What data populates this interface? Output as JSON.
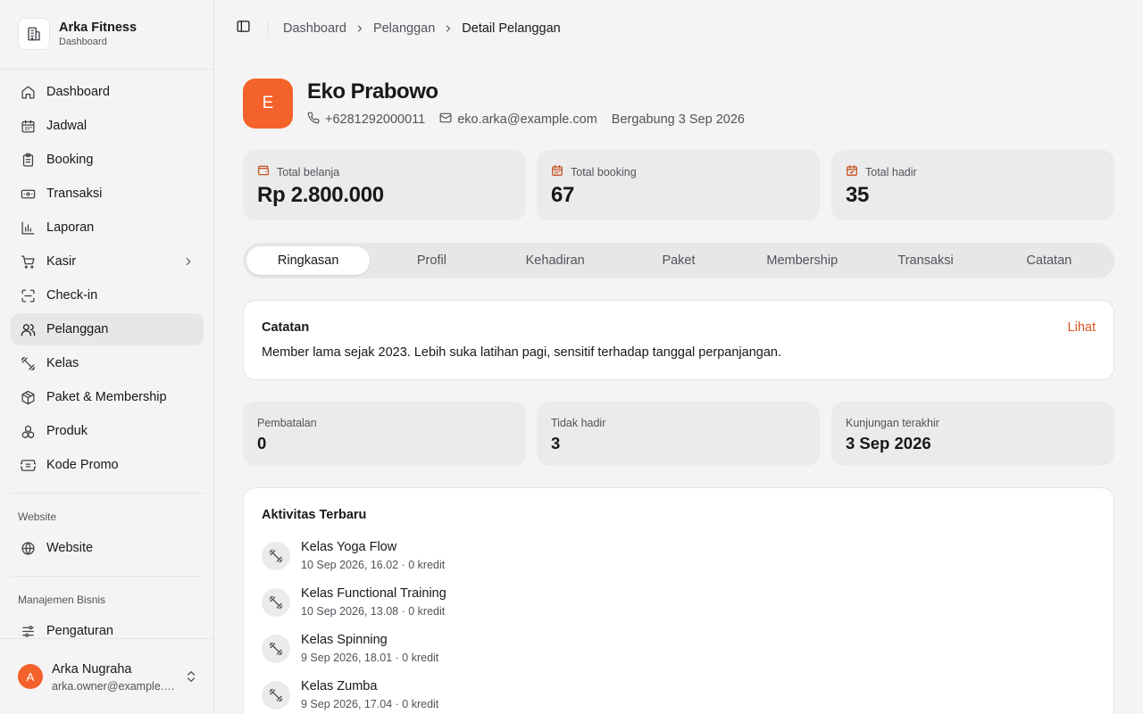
{
  "brand": {
    "name": "Arka Fitness",
    "subtitle": "Dashboard",
    "icon": "building-icon"
  },
  "sidebar": {
    "items": [
      {
        "label": "Dashboard",
        "icon": "home-icon"
      },
      {
        "label": "Jadwal",
        "icon": "calendar-icon"
      },
      {
        "label": "Booking",
        "icon": "clipboard-icon"
      },
      {
        "label": "Transaksi",
        "icon": "banknote-icon"
      },
      {
        "label": "Laporan",
        "icon": "bar-chart-icon"
      },
      {
        "label": "Kasir",
        "icon": "cart-icon"
      },
      {
        "label": "Check-in",
        "icon": "scan-icon"
      },
      {
        "label": "Pelanggan",
        "icon": "users-icon",
        "active": true
      },
      {
        "label": "Kelas",
        "icon": "dumbbell-icon"
      },
      {
        "label": "Paket & Membership",
        "icon": "package-icon"
      },
      {
        "label": "Produk",
        "icon": "boxes-icon"
      },
      {
        "label": "Kode Promo",
        "icon": "ticket-icon"
      }
    ],
    "website_section": "Website",
    "website_items": [
      {
        "label": "Website",
        "icon": "globe-icon"
      }
    ],
    "business_section": "Manajemen Bisnis",
    "business_items": [
      {
        "label": "Pengaturan",
        "icon": "settings-icon"
      }
    ]
  },
  "user": {
    "initial": "A",
    "name": "Arka Nugraha",
    "email": "arka.owner@example.com"
  },
  "breadcrumb": {
    "items": [
      "Dashboard",
      "Pelanggan"
    ],
    "current": "Detail Pelanggan"
  },
  "customer": {
    "initial": "E",
    "name": "Eko Prabowo",
    "phone": "+6281292000011",
    "email": "eko.arka@example.com",
    "joined": "Bergabung 3 Sep 2026"
  },
  "stats": [
    {
      "label": "Total belanja",
      "value": "Rp 2.800.000",
      "icon": "wallet-icon"
    },
    {
      "label": "Total booking",
      "value": "67",
      "icon": "calendar-icon"
    },
    {
      "label": "Total hadir",
      "value": "35",
      "icon": "calendar-check-icon"
    }
  ],
  "tabs": [
    "Ringkasan",
    "Profil",
    "Kehadiran",
    "Paket",
    "Membership",
    "Transaksi",
    "Catatan"
  ],
  "active_tab": "Ringkasan",
  "notes": {
    "title": "Catatan",
    "link": "Lihat",
    "body": "Member lama sejak 2023. Lebih suka latihan pagi, sensitif terhadap tanggal perpanjangan."
  },
  "mini_stats": [
    {
      "label": "Pembatalan",
      "value": "0"
    },
    {
      "label": "Tidak hadir",
      "value": "3"
    },
    {
      "label": "Kunjungan terakhir",
      "value": "3 Sep 2026"
    }
  ],
  "activity": {
    "title": "Aktivitas Terbaru",
    "items": [
      {
        "title": "Kelas Yoga Flow",
        "sub": "10 Sep 2026, 16.02 · 0 kredit"
      },
      {
        "title": "Kelas Functional Training",
        "sub": "10 Sep 2026, 13.08 · 0 kredit"
      },
      {
        "title": "Kelas Spinning",
        "sub": "9 Sep 2026, 18.01 · 0 kredit"
      },
      {
        "title": "Kelas Zumba",
        "sub": "9 Sep 2026, 17.04 · 0 kredit"
      }
    ]
  },
  "colors": {
    "accent": "#f4622b",
    "link": "#d9541e",
    "icon_accent": "#c2410c"
  }
}
